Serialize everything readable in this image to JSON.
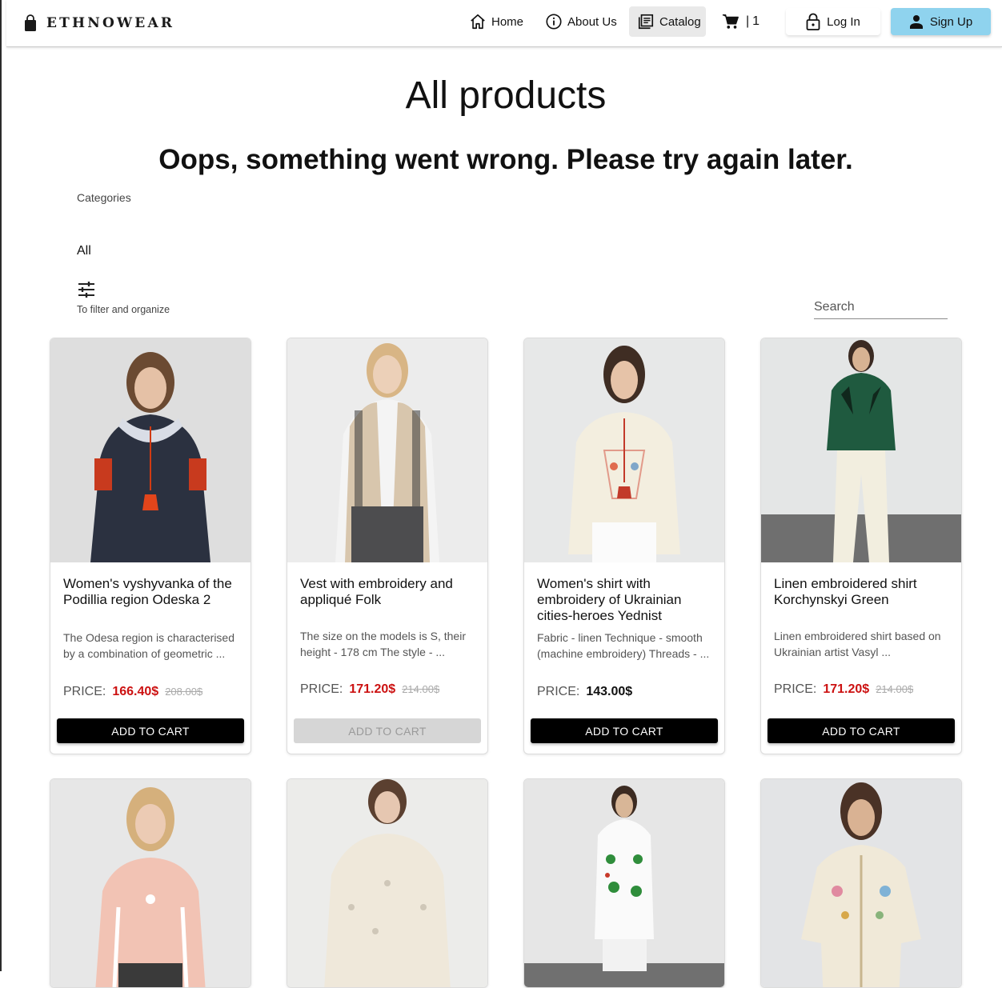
{
  "brand": {
    "name": "ETHNOWEAR",
    "icon": "shopping-bag-icon"
  },
  "nav": {
    "home": {
      "label": "Home",
      "icon": "home-icon"
    },
    "about": {
      "label": "About Us",
      "icon": "info-icon"
    },
    "catalog": {
      "label": "Catalog",
      "icon": "catalog-icon",
      "active": true
    },
    "cart": {
      "separator": "|",
      "count": "1",
      "icon": "cart-icon"
    },
    "login": {
      "label": "Log In",
      "icon": "lock-icon"
    },
    "signup": {
      "label": "Sign Up",
      "icon": "user-icon"
    }
  },
  "page": {
    "title": "All products",
    "error": "Oops, something went wrong. Please try again later.",
    "categories_label": "Categories",
    "category_selected": "All",
    "filter_label": "To filter and organize",
    "filter_icon": "sliders-icon",
    "search_placeholder": "Search"
  },
  "colors": {
    "accent_signup": "#8fd3ee",
    "sale_price": "#cc1111",
    "button": "#000000",
    "button_disabled": "#d6d6d6"
  },
  "products": [
    {
      "title": "Women's vyshyvanka of the Podillia region Odeska 2",
      "description": "The Odesa region is characterised by a combination of geometric ...",
      "price_label": "PRICE:",
      "price": "166.40$",
      "old_price": "208.00$",
      "button": "ADD TO CART",
      "button_enabled": true,
      "image": "navy linen blouse with white embroidery and red tassel"
    },
    {
      "title": "Vest with embroidery and appliqué Folk",
      "description": "The size on the models is S, their height - 178 cm The style - ...",
      "price_label": "PRICE:",
      "price": "171.20$",
      "old_price": "214.00$",
      "button": "ADD TO CART",
      "button_enabled": false,
      "image": "beige embroidered vest over white shirt"
    },
    {
      "title": "Women's shirt with embroidery of Ukrainian cities-heroes Yednist",
      "description": "Fabric - linen Technique - smooth (machine embroidery) Threads - ...",
      "price_label": "PRICE:",
      "price": "143.00$",
      "old_price": "",
      "button": "ADD TO CART",
      "button_enabled": true,
      "image": "cream linen blouse with red floral embroidery"
    },
    {
      "title": "Linen embroidered shirt Korchynskyi Green",
      "description": "Linen embroidered shirt based on Ukrainian artist Vasyl ...",
      "price_label": "PRICE:",
      "price": "171.20$",
      "old_price": "214.00$",
      "button": "ADD TO CART",
      "button_enabled": true,
      "image": "green embroidered blouse with cream trousers"
    },
    {
      "image": "pink embroidered blouse"
    },
    {
      "image": "cream blouse with white embroidery"
    },
    {
      "image": "white shirt with green floral embroidery"
    },
    {
      "image": "cream shirt with colorful floral embroidery"
    }
  ]
}
